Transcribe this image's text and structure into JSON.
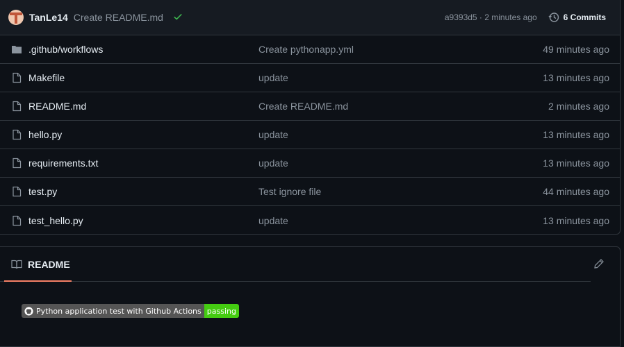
{
  "latest_commit": {
    "author": "TanLe14",
    "message": "Create README.md",
    "status_icon": "check-icon",
    "sha_time": "a9393d5 · 2 minutes ago",
    "commits_label": "6 Commits"
  },
  "files": [
    {
      "name": ".github/workflows",
      "type": "folder",
      "commit": "Create pythonapp.yml",
      "age": "49 minutes ago"
    },
    {
      "name": "Makefile",
      "type": "file",
      "commit": "update",
      "age": "13 minutes ago"
    },
    {
      "name": "README.md",
      "type": "file",
      "commit": "Create README.md",
      "age": "2 minutes ago"
    },
    {
      "name": "hello.py",
      "type": "file",
      "commit": "update",
      "age": "13 minutes ago"
    },
    {
      "name": "requirements.txt",
      "type": "file",
      "commit": "update",
      "age": "13 minutes ago"
    },
    {
      "name": "test.py",
      "type": "file",
      "commit": "Test ignore file",
      "age": "44 minutes ago"
    },
    {
      "name": "test_hello.py",
      "type": "file",
      "commit": "update",
      "age": "13 minutes ago"
    }
  ],
  "readme": {
    "tab_label": "README",
    "badge_label": "Python application test with Github Actions",
    "badge_status": "passing"
  },
  "colors": {
    "accent_underline": "#f78166",
    "badge_pass": "#44cc11",
    "check": "#3fb950"
  }
}
